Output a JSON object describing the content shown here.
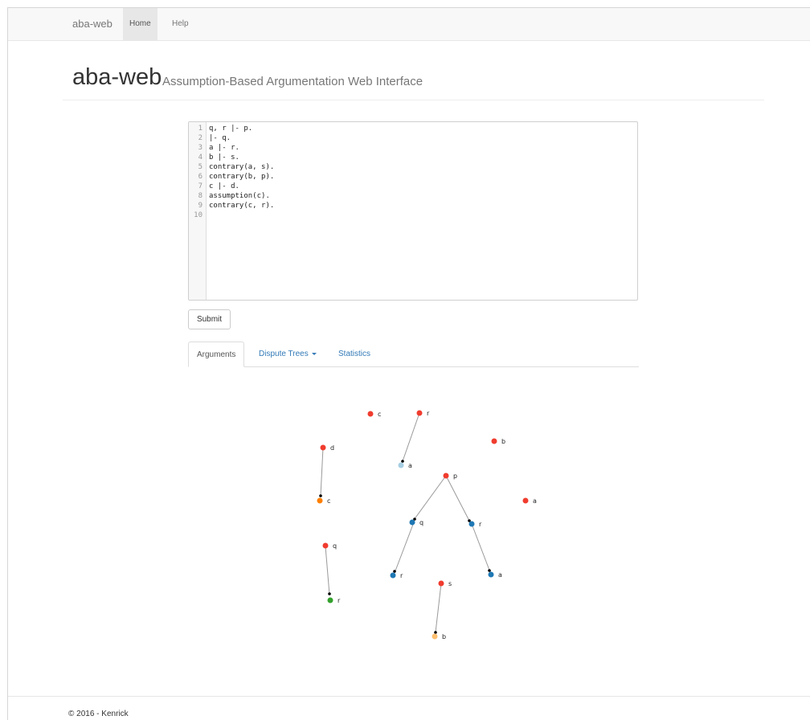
{
  "navbar": {
    "brand": "aba-web",
    "items": [
      {
        "label": "Home",
        "active": true
      },
      {
        "label": "Help",
        "active": false
      }
    ]
  },
  "header": {
    "title": "aba-web",
    "subtitle": "Assumption-Based Argumentation Web Interface"
  },
  "editor": {
    "lines": [
      {
        "number": "1",
        "code": "q, r |- p."
      },
      {
        "number": "2",
        "code": "|- q."
      },
      {
        "number": "3",
        "code": "a |- r."
      },
      {
        "number": "4",
        "code": "b |- s."
      },
      {
        "number": "5",
        "code": "contrary(a, s)."
      },
      {
        "number": "6",
        "code": "contrary(b, p)."
      },
      {
        "number": "7",
        "code": "c |- d."
      },
      {
        "number": "8",
        "code": "assumption(c)."
      },
      {
        "number": "9",
        "code": "contrary(c, r)."
      },
      {
        "number": "10",
        "code": ""
      }
    ]
  },
  "submit_label": "Submit",
  "tabs": [
    {
      "label": "Arguments",
      "active": true
    },
    {
      "label": "Dispute Trees",
      "dropdown": true
    },
    {
      "label": "Statistics"
    }
  ],
  "graph": {
    "node_labels": {
      "c_top": "c",
      "r_top": "r",
      "b_right": "b",
      "d": "d",
      "a_mid": "a",
      "p": "p",
      "c_mid": "c",
      "a_right": "a",
      "q_mid": "q",
      "r_mid": "r",
      "q_left": "q",
      "r_low": "r",
      "a_low": "a",
      "s": "s",
      "r_bottom": "r",
      "b_bottom": "b"
    },
    "colors": {
      "claim": "#f03c2e",
      "blue": "#1f78b4",
      "light_blue": "#a6cee3",
      "orange": "#ff7f00",
      "green": "#33a02c",
      "light_orange": "#fdbf6f",
      "edge": "#999999"
    }
  },
  "footer": "© 2016 - Kenrick"
}
